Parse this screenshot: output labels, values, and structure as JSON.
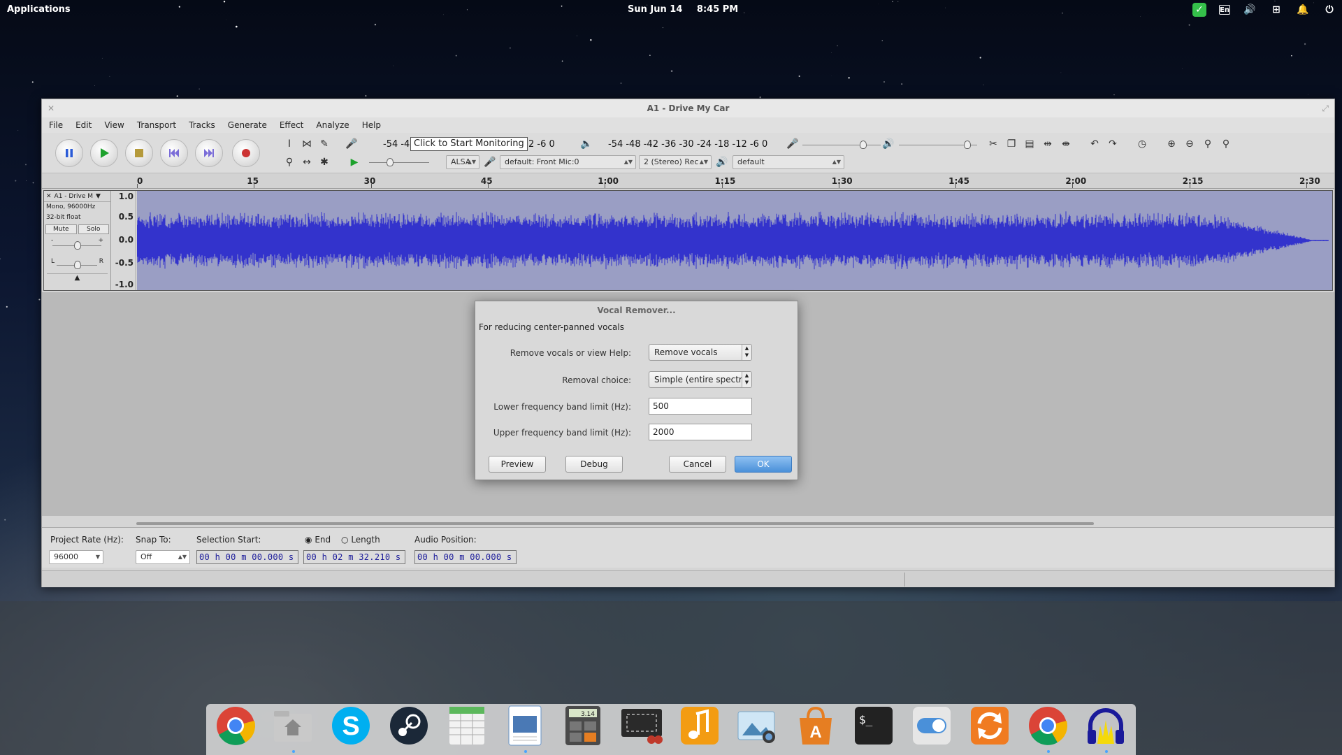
{
  "top_panel": {
    "applications": "Applications",
    "date": "Sun Jun 14",
    "time": "8:45 PM",
    "lang": "En"
  },
  "window": {
    "title": "A1 - Drive My Car",
    "menu": [
      "File",
      "Edit",
      "View",
      "Transport",
      "Tracks",
      "Generate",
      "Effect",
      "Analyze",
      "Help"
    ]
  },
  "toolbar": {
    "record_meter": "-54 -4",
    "record_meter_right": "2  -6  0",
    "monitor_tooltip": "Click to Start Monitoring",
    "play_meter": "-54 -48 -42 -36 -30 -24 -18 -12  -6  0",
    "host": "ALSA",
    "rec_device": "default: Front Mic:0",
    "channels": "2 (Stereo) Rec",
    "play_device": "default"
  },
  "ruler": {
    "ticks": [
      "0",
      "15",
      "30",
      "45",
      "1:00",
      "1:15",
      "1:30",
      "1:45",
      "2:00",
      "2:15",
      "2:30"
    ]
  },
  "track": {
    "name": "A1 - Drive M",
    "format": "Mono, 96000Hz",
    "bits": "32-bit float",
    "mute": "Mute",
    "solo": "Solo",
    "gain_minus": "-",
    "gain_plus": "+",
    "pan_left": "L",
    "pan_right": "R",
    "scale": [
      "1.0",
      "0.5",
      "0.0",
      "-0.5",
      "-1.0"
    ]
  },
  "selection_bar": {
    "project_rate_label": "Project Rate (Hz):",
    "project_rate": "96000",
    "snap_label": "Snap To:",
    "snap_value": "Off",
    "sel_start_label": "Selection Start:",
    "end_label": "End",
    "length_label": "Length",
    "audio_pos_label": "Audio Position:",
    "sel_start": "00 h 00 m 00.000 s",
    "sel_end": "00 h 02 m 32.210 s",
    "audio_pos": "00 h 00 m 00.000 s"
  },
  "dialog": {
    "title": "Vocal Remover...",
    "subtitle": "For reducing center-panned vocals",
    "remove_label": "Remove vocals or view Help:",
    "remove_value": "Remove vocals",
    "choice_label": "Removal choice:",
    "choice_value": "Simple (entire spectru",
    "lower_label": "Lower frequency band limit (Hz):",
    "lower_value": "500",
    "upper_label": "Upper frequency band limit (Hz):",
    "upper_value": "2000",
    "preview": "Preview",
    "debug": "Debug",
    "cancel": "Cancel",
    "ok": "OK"
  },
  "dock": {
    "calculator_display": "3.14",
    "terminal_prompt": "$_"
  },
  "colors": {
    "waveform": "#3333cc",
    "waveform_bg": "#9a9ec4",
    "ok_button": "#4a90d9",
    "timecode": "#1a1a9a"
  }
}
